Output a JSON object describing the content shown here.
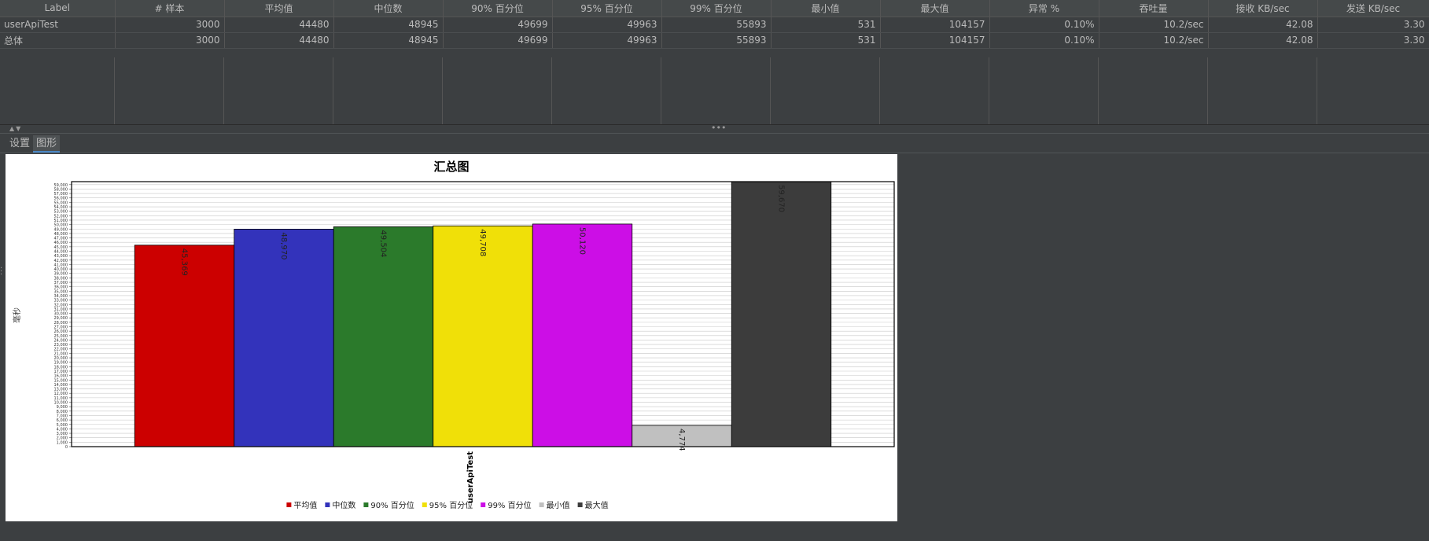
{
  "table": {
    "headers": [
      "Label",
      "# 样本",
      "平均值",
      "中位数",
      "90% 百分位",
      "95% 百分位",
      "99% 百分位",
      "最小值",
      "最大值",
      "异常 %",
      "吞吐量",
      "接收 KB/sec",
      "发送 KB/sec"
    ],
    "rows": [
      [
        "userApiTest",
        "3000",
        "44480",
        "48945",
        "49699",
        "49963",
        "55893",
        "531",
        "104157",
        "0.10%",
        "10.2/sec",
        "42.08",
        "3.30"
      ],
      [
        "总体",
        "3000",
        "44480",
        "48945",
        "49699",
        "49963",
        "55893",
        "531",
        "104157",
        "0.10%",
        "10.2/sec",
        "42.08",
        "3.30"
      ]
    ]
  },
  "tabs": [
    {
      "label": "设置",
      "active": false
    },
    {
      "label": "图形",
      "active": true
    }
  ],
  "chart_data": {
    "type": "bar",
    "title": "汇总图",
    "ylabel": "毫秒",
    "xlabel": "",
    "categories": [
      "userApiTest"
    ],
    "ylim": [
      0,
      59670
    ],
    "series": [
      {
        "name": "平均值",
        "color": "#cc0000",
        "values": [
          45369
        ],
        "label": "45,369"
      },
      {
        "name": "中位数",
        "color": "#3333bb",
        "values": [
          48970
        ],
        "label": "48,970"
      },
      {
        "name": "90% 百分位",
        "color": "#2b7a2b",
        "values": [
          49504
        ],
        "label": "49,504"
      },
      {
        "name": "95% 百分位",
        "color": "#f0e008",
        "values": [
          49708
        ],
        "label": "49,708"
      },
      {
        "name": "99% 百分位",
        "color": "#cc0ee6",
        "values": [
          50120
        ],
        "label": "50,120"
      },
      {
        "name": "最小值",
        "color": "#c0c0c0",
        "values": [
          4774
        ],
        "label": "4,774"
      },
      {
        "name": "最大值",
        "color": "#3c3c3c",
        "values": [
          59670
        ],
        "label": "59,670"
      }
    ],
    "grid": true,
    "legend": "bottom"
  }
}
